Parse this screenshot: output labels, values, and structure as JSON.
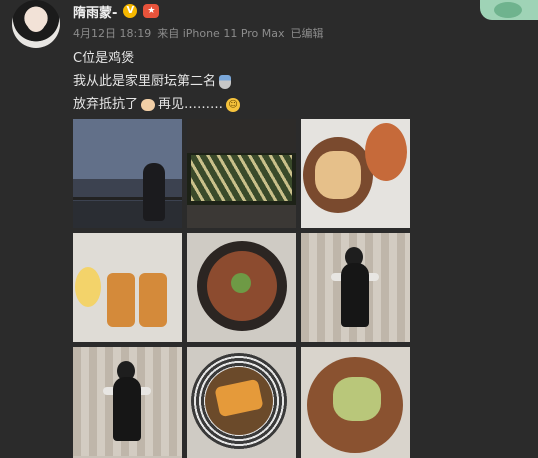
{
  "post": {
    "username": "隋雨蒙-",
    "verified_badge": "V",
    "level_badge": "★",
    "date": "4月12日 18:19",
    "source": "来自 iPhone 11 Pro Max",
    "edited": "已编辑",
    "lines": [
      "C位是鸡煲",
      "我从此是家里厨坛第二名",
      "放弃抵抗了",
      "再见………"
    ]
  },
  "images": [
    {
      "name": "photo-city-balcony"
    },
    {
      "name": "photo-plants"
    },
    {
      "name": "photo-bread-plate"
    },
    {
      "name": "photo-toast-board"
    },
    {
      "name": "photo-noodle-bowl"
    },
    {
      "name": "photo-girl-standing"
    },
    {
      "name": "photo-girl-posing"
    },
    {
      "name": "photo-noodle-tofu"
    },
    {
      "name": "photo-plate-food"
    }
  ],
  "icons": {
    "verified": "verified-v-icon",
    "medal": "medal-icon",
    "clap": "clapping-hands-icon",
    "smile": "smile-icon"
  },
  "colors": {
    "background": "#2b2b2b",
    "text": "#e6e6e6",
    "meta": "#8c8c8c",
    "verified": "#f5b700"
  }
}
